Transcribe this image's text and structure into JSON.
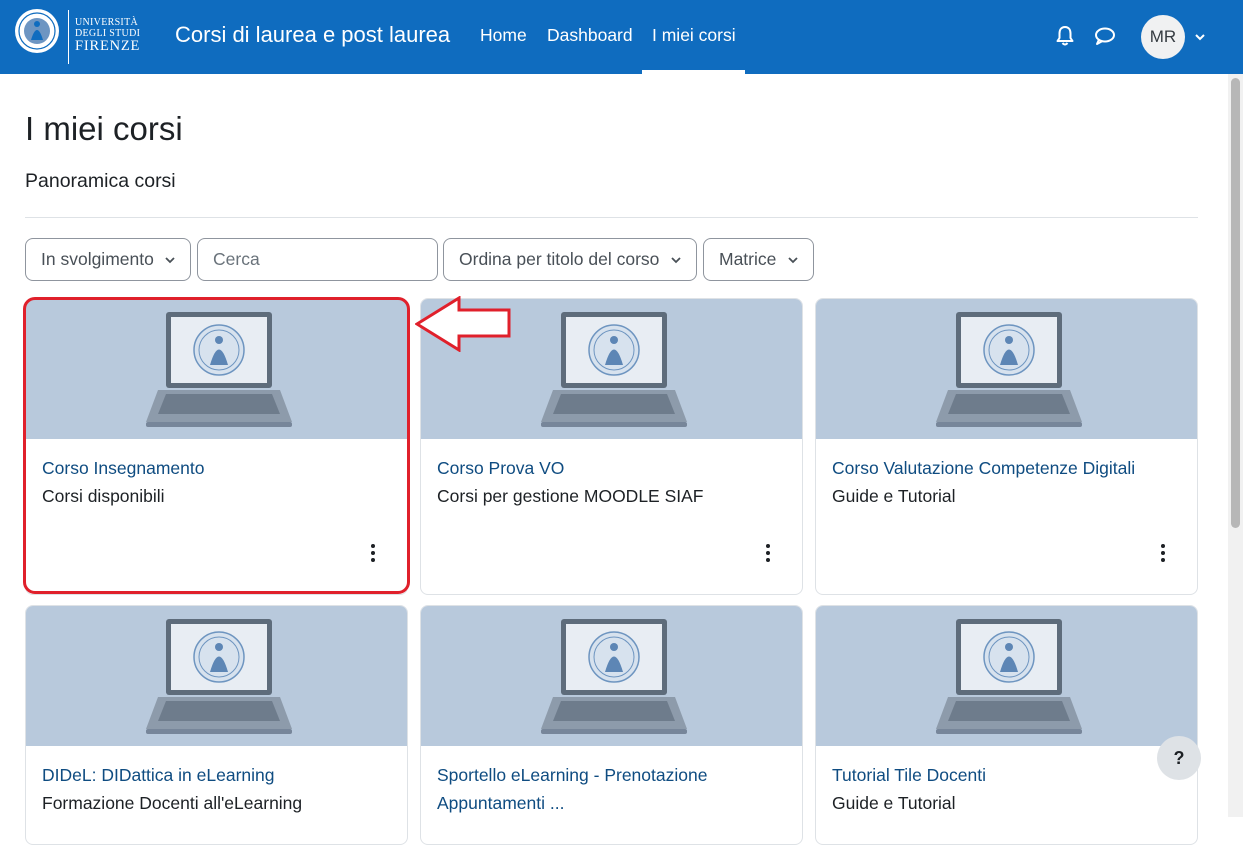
{
  "header": {
    "logo": {
      "line1": "UNIVERSITÀ",
      "line2": "DEGLI STUDI",
      "line3": "FIRENZE",
      "seal_icon": "university-seal-icon"
    },
    "site_name": "Corsi di laurea e post laurea",
    "nav": [
      {
        "label": "Home",
        "active": false
      },
      {
        "label": "Dashboard",
        "active": false
      },
      {
        "label": "I miei corsi",
        "active": true
      }
    ],
    "notifications_icon": "bell-icon",
    "messages_icon": "chat-bubble-icon",
    "user_initials": "MR",
    "colors": {
      "navbar": "#0f6cbf"
    }
  },
  "page": {
    "title": "I miei corsi",
    "section_title": "Panoramica corsi"
  },
  "filters": {
    "grouping": "In svolgimento",
    "search_placeholder": "Cerca",
    "sort": "Ordina per titolo del corso",
    "view": "Matrice"
  },
  "courses": [
    {
      "name": "Corso Insegnamento",
      "category": "Corsi disponibili"
    },
    {
      "name": "Corso Prova VO",
      "category": "Corsi per gestione MOODLE SIAF"
    },
    {
      "name": "Corso Valutazione Competenze Digitali",
      "category": "Guide e Tutorial"
    },
    {
      "name": "DIDeL: DIDattica in eLearning",
      "category": "Formazione Docenti all'eLearning"
    },
    {
      "name_line1": "Sportello eLearning - Prenotazione",
      "name_line2": "Appuntamenti ..."
    },
    {
      "name": "Tutorial Tile Docenti",
      "category": "Guide e Tutorial"
    }
  ],
  "help_button": "?",
  "annotation": {
    "highlight_color": "#e0202b"
  }
}
